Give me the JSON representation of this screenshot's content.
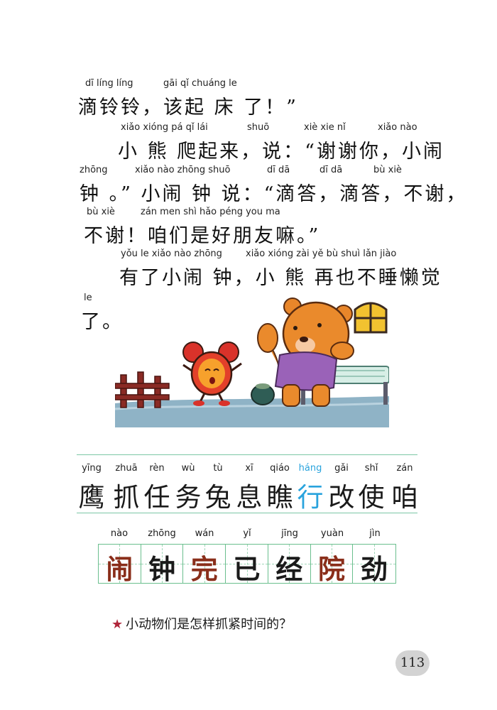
{
  "story": {
    "l1": {
      "py": [
        "dī líng líng",
        "gāi qǐ chuáng le"
      ],
      "hz": "滴铃铃，该起 床 了！”"
    },
    "l2": {
      "py": [
        "xiǎo xióng pá qǐ lái",
        "shuō",
        "xiè xie nǐ",
        "xiǎo nào"
      ],
      "hz": "小 熊 爬起来，说：“谢谢你，小闹"
    },
    "l3": {
      "py": [
        "zhōng",
        "xiǎo nào zhōng shuō",
        "dī dā",
        "dī dā",
        "bù xiè"
      ],
      "hz": "钟 。” 小闹 钟 说：“滴答，滴答，不谢，"
    },
    "l4": {
      "py": [
        "bù xiè",
        "zán men shì hǎo péng you ma"
      ],
      "hz": "不谢！咱们是好朋友嘛。”"
    },
    "l5": {
      "py": [
        "yǒu le xiǎo nào zhōng",
        "xiǎo xióng zài yě bù shuì lǎn jiào"
      ],
      "hz": "有了小闹 钟，小 熊 再也不睡懒觉"
    },
    "l6": {
      "py": [
        "le"
      ],
      "hz": "了。"
    }
  },
  "read_chars": {
    "py": [
      "yīng",
      "zhuā",
      "rèn",
      "wù",
      "tù",
      "xī",
      "qiáo",
      "háng",
      "gǎi",
      "shǐ",
      "zán"
    ],
    "hz": [
      "鹰",
      "抓",
      "任",
      "务",
      "兔",
      "息",
      "瞧",
      "行",
      "改",
      "使",
      "咱"
    ],
    "highlight_index": 7,
    "highlight_color": "#29a3dd"
  },
  "write_chars": {
    "py": [
      "nào",
      "zhōng",
      "wán",
      "yǐ",
      "jīng",
      "yuàn",
      "jìn"
    ],
    "hz": [
      "闹",
      "钟",
      "完",
      "已",
      "经",
      "院",
      "劲"
    ],
    "red_indices": [
      0,
      2,
      5
    ],
    "red_color": "#8a2e1a"
  },
  "question": {
    "star": "★",
    "text": "小动物们是怎样抓紧时间的？"
  },
  "page_number": "113"
}
